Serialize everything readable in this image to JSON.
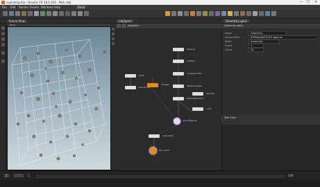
{
  "window": {
    "title": "exploding.hip - Houdini FX 18.0.416 - Path /obj",
    "minimize": "—",
    "maximize": "☐",
    "close": "✕"
  },
  "menubar": [
    "File",
    "Edit",
    "Render",
    "Assets",
    "Windows",
    "Help"
  ],
  "desktop": "Build",
  "tabs": {
    "scene_view": "Scene View",
    "network": "/obj/geo1",
    "params": "Geometry geo1",
    "tree": "Tree View"
  },
  "viewport": {
    "label": "Persp"
  },
  "nodes": [
    {
      "label": "sphere1"
    },
    {
      "label": "scatter1"
    },
    {
      "label": "copytopoints1"
    },
    {
      "label": "attribwrangle1"
    },
    {
      "label": "rbdbulletsolver1"
    },
    {
      "label": "dopnet1"
    },
    {
      "label": "null1"
    },
    {
      "label": "grid1"
    },
    {
      "label": "transform1"
    },
    {
      "label": "merge1"
    },
    {
      "label": "rbdconfigure1"
    },
    {
      "label": "output_file"
    },
    {
      "label": "file_cache"
    }
  ],
  "params": {
    "rows": [
      {
        "label": "Name",
        "value": "Geometry"
      },
      {
        "label": "Source Path",
        "value": "$HIP/geo/$OS.$F4.bgeo.sc"
      },
      {
        "label": "Mode",
        "value": "Automatic"
      },
      {
        "label": "Frame",
        "value": "1"
      },
      {
        "label": "Cache",
        "value": "On"
      }
    ]
  },
  "timeline": {
    "frame": "1",
    "start": "1",
    "end": "240"
  },
  "colors": {
    "orange_node": "#e8891e",
    "viewport_top": "#6b8696",
    "viewport_bottom": "#cfd9de",
    "wire_blue": "#4a7fd6"
  }
}
